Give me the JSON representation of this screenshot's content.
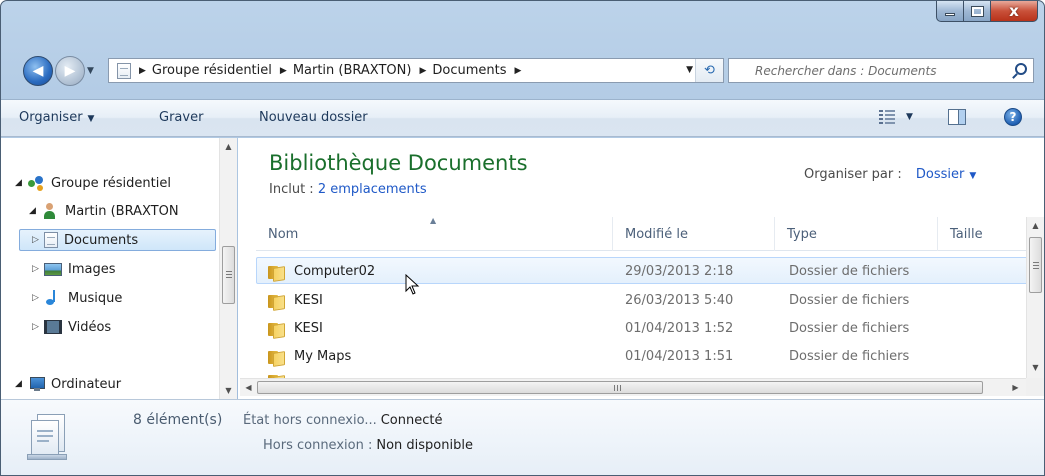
{
  "window": {
    "close_glyph": "x"
  },
  "address_bar": {
    "breadcrumbs": [
      "Groupe résidentiel",
      "Martin (BRAXTON)",
      "Documents"
    ]
  },
  "search": {
    "placeholder": "Rechercher dans : Documents"
  },
  "toolbar": {
    "organize_label": "Organiser",
    "burn_label": "Graver",
    "new_folder_label": "Nouveau dossier"
  },
  "nav_pane": {
    "items": [
      {
        "label": "Groupe résidentiel",
        "icon": "homegroup-icon",
        "expanded": true
      },
      {
        "label": "Martin (BRAXTON",
        "icon": "user-icon",
        "expanded": true
      },
      {
        "label": "Documents",
        "icon": "documents-icon",
        "selected": true
      },
      {
        "label": "Images",
        "icon": "images-icon"
      },
      {
        "label": "Musique",
        "icon": "music-icon"
      },
      {
        "label": "Vidéos",
        "icon": "videos-icon"
      },
      {
        "label": "Ordinateur",
        "icon": "computer-icon",
        "expanded": true
      }
    ]
  },
  "library": {
    "title": "Bibliothèque Documents",
    "includes_label": "Inclut :",
    "includes_link": "2 emplacements",
    "arrange_label": "Organiser par :",
    "arrange_value": "Dossier"
  },
  "file_list": {
    "columns": [
      "Nom",
      "Modifié le",
      "Type",
      "Taille"
    ],
    "rows": [
      {
        "name": "Computer02",
        "modified": "29/03/2013 2:18",
        "type": "Dossier de fichiers",
        "hover": true
      },
      {
        "name": "KESI",
        "modified": "26/03/2013 5:40",
        "type": "Dossier de fichiers"
      },
      {
        "name": "KESI",
        "modified": "01/04/2013 1:52",
        "type": "Dossier de fichiers"
      },
      {
        "name": "My Maps",
        "modified": "01/04/2013 1:51",
        "type": "Dossier de fichiers"
      }
    ]
  },
  "details": {
    "count": "8 élément(s)",
    "offline_status_label": "État hors connexio...",
    "offline_status_value": "Connecté",
    "offline_label": "Hors connexion :",
    "offline_value": "Non disponible"
  },
  "colors": {
    "library_title": "#1a6f2c",
    "link": "#1f59c7",
    "hover_border": "#b8d6fb"
  }
}
